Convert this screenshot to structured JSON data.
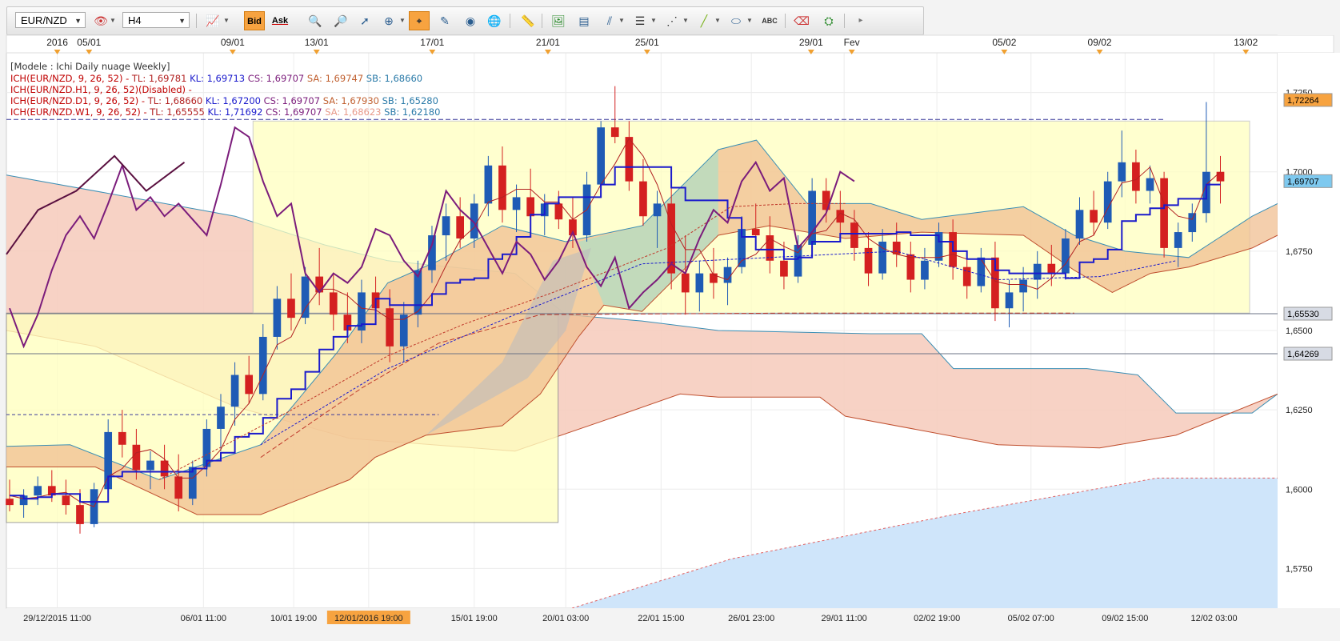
{
  "toolbar": {
    "symbol": "EUR/NZD",
    "timeframe": "H4",
    "bid_label": "Bid",
    "ask_label": "Ask"
  },
  "legend": {
    "title": "[Modele : Ichi Daily nuage Weekly]",
    "lines": [
      {
        "prefix": "ICH(EUR/NZD, 9, 26, 52) - ",
        "tl": "TL: 1,69781",
        "kl": "KL: 1,69713",
        "cs": "CS: 1,69707",
        "sa": "SA: 1,69747",
        "sb": "SB: 1,68660",
        "color": "#c00000"
      },
      {
        "prefix": "ICH(EUR/NZD.H1, 9, 26, 52)(Disabled) -",
        "tl": "",
        "kl": "",
        "cs": "",
        "sa": "",
        "sb": "",
        "color": "#c00000"
      },
      {
        "prefix": "ICH(EUR/NZD.D1, 9, 26, 52) - ",
        "tl": "TL: 1,68660",
        "kl": "KL: 1,67200",
        "cs": "CS: 1,69707",
        "sa": "SA: 1,67930",
        "sb": "SB: 1,65280",
        "color": "#c00000"
      },
      {
        "prefix": "ICH(EUR/NZD.W1, 9, 26, 52) - ",
        "tl": "TL: 1,65555",
        "kl": "KL: 1,71692",
        "cs": "CS: 1,69707",
        "sa": "SA: 1,68623",
        "sb": "SB: 1,62180",
        "color": "#c00000"
      }
    ]
  },
  "colors": {
    "tenkan": "#b22222",
    "kijun": "#1a1acc",
    "chikou": "#7b1c7b",
    "cloud_bull": "#bfe0c4",
    "cloud_bear": "#f3c1b4",
    "daily_cloud": "#f8c8b6",
    "weekly_cloud": "#cde4f7",
    "up_candle": "#1f5bb5",
    "down_candle": "#d42020",
    "highlight_box": "#ffffc8"
  },
  "chart_data": {
    "type": "candlestick",
    "symbol": "EUR/NZD",
    "timeframe": "H4",
    "y_ticks": [
      "1,7250",
      "1,7000",
      "1,6750",
      "1,6500",
      "1,6250",
      "1,6000",
      "1,5750"
    ],
    "y_values": [
      1.725,
      1.7,
      1.675,
      1.65,
      1.625,
      1.6,
      1.575
    ],
    "price_markers": [
      {
        "label": "1,72264",
        "value": 1.72264,
        "color": "#f7a340"
      },
      {
        "label": "1,69707",
        "value": 1.69707,
        "color": "#7ec9ef"
      },
      {
        "label": "1,65530",
        "value": 1.6553,
        "color": "#d7dbe4"
      },
      {
        "label": "1,64269",
        "value": 1.64269,
        "color": "#d7dbe4"
      }
    ],
    "top_ticks": [
      {
        "label": "2016",
        "x": 0.04
      },
      {
        "label": "05/01",
        "x": 0.065
      },
      {
        "label": "09/01",
        "x": 0.178
      },
      {
        "label": "13/01",
        "x": 0.244
      },
      {
        "label": "17/01",
        "x": 0.335
      },
      {
        "label": "21/01",
        "x": 0.426
      },
      {
        "label": "25/01",
        "x": 0.504
      },
      {
        "label": "29/01",
        "x": 0.633
      },
      {
        "label": "Fev",
        "x": 0.665
      },
      {
        "label": "05/02",
        "x": 0.785
      },
      {
        "label": "09/02",
        "x": 0.86
      },
      {
        "label": "13/02",
        "x": 0.975
      }
    ],
    "bottom_ticks": [
      {
        "label": "29/12/2015 11:00",
        "x": 0.04
      },
      {
        "label": "06/01 11:00",
        "x": 0.155
      },
      {
        "label": "10/01 19:00",
        "x": 0.226
      },
      {
        "label": "12/01/2016 19:00",
        "x": 0.285,
        "highlight": true
      },
      {
        "label": "15/01 19:00",
        "x": 0.368
      },
      {
        "label": "20/01 03:00",
        "x": 0.44
      },
      {
        "label": "22/01 15:00",
        "x": 0.515
      },
      {
        "label": "26/01 23:00",
        "x": 0.586
      },
      {
        "label": "29/01 11:00",
        "x": 0.659
      },
      {
        "label": "02/02 19:00",
        "x": 0.732
      },
      {
        "label": "05/02 07:00",
        "x": 0.806
      },
      {
        "label": "09/02 15:00",
        "x": 0.88
      },
      {
        "label": "12/02 03:00",
        "x": 0.95
      }
    ],
    "ohlc": [
      [
        1.597,
        1.603,
        1.593,
        1.595
      ],
      [
        1.595,
        1.6,
        1.591,
        1.598
      ],
      [
        1.598,
        1.604,
        1.595,
        1.601
      ],
      [
        1.601,
        1.606,
        1.596,
        1.598
      ],
      [
        1.598,
        1.603,
        1.592,
        1.595
      ],
      [
        1.595,
        1.6,
        1.586,
        1.589
      ],
      [
        1.589,
        1.602,
        1.588,
        1.6
      ],
      [
        1.6,
        1.622,
        1.598,
        1.618
      ],
      [
        1.618,
        1.625,
        1.61,
        1.614
      ],
      [
        1.614,
        1.619,
        1.603,
        1.606
      ],
      [
        1.606,
        1.612,
        1.6,
        1.609
      ],
      [
        1.609,
        1.614,
        1.6,
        1.604
      ],
      [
        1.604,
        1.611,
        1.593,
        1.597
      ],
      [
        1.597,
        1.609,
        1.595,
        1.607
      ],
      [
        1.607,
        1.622,
        1.604,
        1.619
      ],
      [
        1.619,
        1.63,
        1.612,
        1.626
      ],
      [
        1.626,
        1.64,
        1.62,
        1.636
      ],
      [
        1.636,
        1.642,
        1.627,
        1.63
      ],
      [
        1.63,
        1.652,
        1.628,
        1.648
      ],
      [
        1.648,
        1.664,
        1.644,
        1.66
      ],
      [
        1.66,
        1.668,
        1.65,
        1.654
      ],
      [
        1.654,
        1.67,
        1.652,
        1.667
      ],
      [
        1.667,
        1.676,
        1.658,
        1.662
      ],
      [
        1.662,
        1.668,
        1.65,
        1.655
      ],
      [
        1.655,
        1.662,
        1.646,
        1.65
      ],
      [
        1.65,
        1.666,
        1.646,
        1.662
      ],
      [
        1.662,
        1.667,
        1.653,
        1.657
      ],
      [
        1.657,
        1.663,
        1.64,
        1.645
      ],
      [
        1.645,
        1.659,
        1.64,
        1.655
      ],
      [
        1.655,
        1.672,
        1.651,
        1.669
      ],
      [
        1.669,
        1.683,
        1.665,
        1.68
      ],
      [
        1.68,
        1.69,
        1.672,
        1.686
      ],
      [
        1.686,
        1.692,
        1.676,
        1.679
      ],
      [
        1.679,
        1.693,
        1.676,
        1.69
      ],
      [
        1.69,
        1.705,
        1.686,
        1.702
      ],
      [
        1.702,
        1.708,
        1.684,
        1.688
      ],
      [
        1.688,
        1.696,
        1.681,
        1.692
      ],
      [
        1.692,
        1.701,
        1.684,
        1.686
      ],
      [
        1.686,
        1.693,
        1.68,
        1.69
      ],
      [
        1.69,
        1.694,
        1.682,
        1.685
      ],
      [
        1.685,
        1.692,
        1.676,
        1.68
      ],
      [
        1.68,
        1.7,
        1.678,
        1.696
      ],
      [
        1.696,
        1.716,
        1.694,
        1.714
      ],
      [
        1.714,
        1.727,
        1.709,
        1.711
      ],
      [
        1.711,
        1.716,
        1.694,
        1.697
      ],
      [
        1.697,
        1.704,
        1.683,
        1.686
      ],
      [
        1.686,
        1.694,
        1.676,
        1.69
      ],
      [
        1.69,
        1.696,
        1.663,
        1.668
      ],
      [
        1.668,
        1.68,
        1.655,
        1.662
      ],
      [
        1.662,
        1.672,
        1.656,
        1.668
      ],
      [
        1.668,
        1.676,
        1.66,
        1.665
      ],
      [
        1.665,
        1.673,
        1.658,
        1.67
      ],
      [
        1.67,
        1.686,
        1.668,
        1.682
      ],
      [
        1.682,
        1.69,
        1.676,
        1.68
      ],
      [
        1.68,
        1.686,
        1.668,
        1.672
      ],
      [
        1.672,
        1.678,
        1.663,
        1.667
      ],
      [
        1.667,
        1.68,
        1.665,
        1.677
      ],
      [
        1.677,
        1.698,
        1.676,
        1.694
      ],
      [
        1.694,
        1.698,
        1.684,
        1.688
      ],
      [
        1.688,
        1.694,
        1.68,
        1.684
      ],
      [
        1.684,
        1.688,
        1.672,
        1.676
      ],
      [
        1.676,
        1.681,
        1.664,
        1.668
      ],
      [
        1.668,
        1.682,
        1.666,
        1.678
      ],
      [
        1.678,
        1.684,
        1.67,
        1.674
      ],
      [
        1.674,
        1.678,
        1.662,
        1.666
      ],
      [
        1.666,
        1.676,
        1.663,
        1.672
      ],
      [
        1.672,
        1.684,
        1.67,
        1.681
      ],
      [
        1.681,
        1.685,
        1.666,
        1.67
      ],
      [
        1.67,
        1.674,
        1.66,
        1.664
      ],
      [
        1.664,
        1.676,
        1.662,
        1.673
      ],
      [
        1.673,
        1.678,
        1.653,
        1.657
      ],
      [
        1.657,
        1.666,
        1.651,
        1.662
      ],
      [
        1.662,
        1.67,
        1.656,
        1.666
      ],
      [
        1.666,
        1.675,
        1.66,
        1.671
      ],
      [
        1.671,
        1.677,
        1.664,
        1.668
      ],
      [
        1.668,
        1.682,
        1.666,
        1.679
      ],
      [
        1.679,
        1.692,
        1.677,
        1.688
      ],
      [
        1.688,
        1.694,
        1.68,
        1.684
      ],
      [
        1.684,
        1.7,
        1.682,
        1.697
      ],
      [
        1.697,
        1.713,
        1.692,
        1.703
      ],
      [
        1.703,
        1.707,
        1.69,
        1.694
      ],
      [
        1.694,
        1.702,
        1.69,
        1.698
      ],
      [
        1.698,
        1.7,
        1.673,
        1.676
      ],
      [
        1.676,
        1.684,
        1.67,
        1.681
      ],
      [
        1.681,
        1.69,
        1.678,
        1.687
      ],
      [
        1.687,
        1.722,
        1.684,
        1.7
      ],
      [
        1.7,
        1.705,
        1.69,
        1.697
      ]
    ]
  }
}
